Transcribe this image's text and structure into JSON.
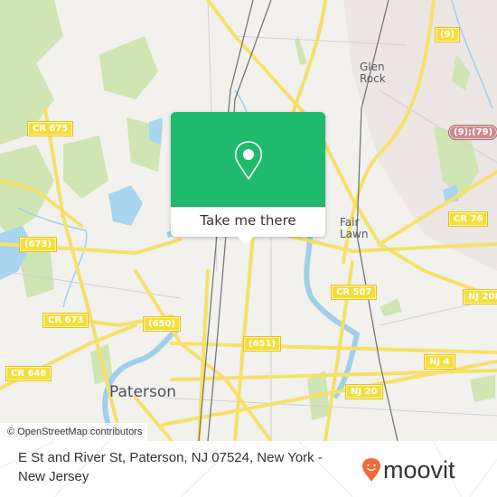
{
  "map": {
    "attribution": "© OpenStreetMap contributors",
    "places": [
      {
        "name": "Glen Rock",
        "lines": [
          "Glen",
          "Rock"
        ]
      },
      {
        "name": "Fair Lawn",
        "lines": [
          "Fair",
          "Lawn"
        ]
      },
      {
        "name": "Paterson",
        "lines": [
          "Paterson"
        ]
      }
    ],
    "shields": [
      {
        "label": "(9)",
        "type": "yellow"
      },
      {
        "label": "(9);(79)",
        "type": "red"
      },
      {
        "label": "CR 675",
        "type": "yellow"
      },
      {
        "label": "CR 76",
        "type": "yellow"
      },
      {
        "label": "(673)",
        "type": "yellow"
      },
      {
        "label": "CR 507",
        "type": "yellow"
      },
      {
        "label": "NJ 208",
        "type": "yellow"
      },
      {
        "label": "CR 673",
        "type": "yellow"
      },
      {
        "label": "(650)",
        "type": "yellow"
      },
      {
        "label": "(651)",
        "type": "yellow"
      },
      {
        "label": "NJ 4",
        "type": "yellow"
      },
      {
        "label": "CR 646",
        "type": "yellow"
      },
      {
        "label": "NJ 20",
        "type": "yellow"
      }
    ]
  },
  "popup": {
    "icon": "map-pin-icon",
    "button_label": "Take me there",
    "accent_color": "#1fba6c"
  },
  "footer": {
    "address": "E St and River St, Paterson, NJ 07524, New York - New Jersey",
    "brand": "moovit",
    "brand_color": "#f26b3a"
  }
}
